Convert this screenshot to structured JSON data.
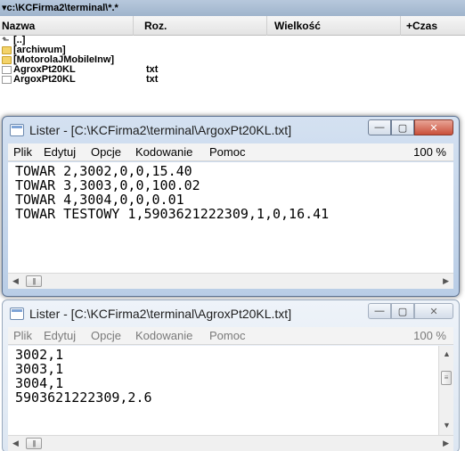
{
  "file_panel": {
    "path": "▾c:\\KCFirma2\\terminal\\*.*",
    "columns": {
      "name": "Nazwa",
      "ext": "Roz.",
      "size": "Wielkość",
      "date": "+Czas"
    },
    "rows": [
      {
        "name": "[..]",
        "ext": "",
        "icon": "up-dir-icon"
      },
      {
        "name": "[archiwum]",
        "ext": "",
        "icon": "folder-icon"
      },
      {
        "name": "[MotorolaJMobileInw]",
        "ext": "",
        "icon": "folder-icon"
      },
      {
        "name": "AgroxPt20KL",
        "ext": "txt",
        "icon": "file-icon"
      },
      {
        "name": "ArgoxPt20KL",
        "ext": "txt",
        "icon": "file-icon"
      }
    ]
  },
  "lister_active": {
    "title": "Lister - [C:\\KCFirma2\\terminal\\ArgoxPt20KL.txt]",
    "menu": [
      "Plik",
      "Edytuj",
      "Opcje",
      "Kodowanie",
      "Pomoc"
    ],
    "zoom": "100 %",
    "content": "TOWAR 2,3002,0,0,15.40\nTOWAR 3,3003,0,0,100.02\nTOWAR 4,3004,0,0,0.01\nTOWAR TESTOWY 1,5903621222309,1,0,16.41"
  },
  "lister_inactive": {
    "title": "Lister - [C:\\KCFirma2\\terminal\\AgroxPt20KL.txt]",
    "menu": [
      "Plik",
      "Edytuj",
      "Opcje",
      "Kodowanie",
      "Pomoc"
    ],
    "zoom": "100 %",
    "content": "3002,1\n3003,1\n3004,1\n5903621222309,2.6"
  },
  "colors": {
    "title_active": "#c2d4ea",
    "title_inactive": "#e6edf6",
    "close_button": "#c9503a",
    "folder": "#f3d36a"
  }
}
